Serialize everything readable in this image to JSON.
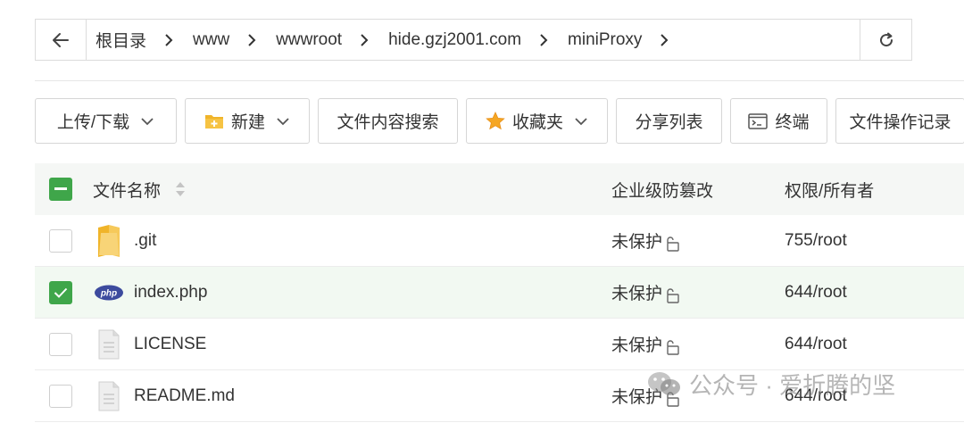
{
  "breadcrumb": {
    "items": [
      "根目录",
      "www",
      "wwwroot",
      "hide.gzj2001.com",
      "miniProxy"
    ]
  },
  "toolbar": {
    "upload_download": "上传/下载",
    "new": "新建",
    "content_search": "文件内容搜索",
    "favorites": "收藏夹",
    "share_list": "分享列表",
    "terminal": "终端",
    "operation_log": "文件操作记录"
  },
  "table": {
    "headers": {
      "name": "文件名称",
      "protect": "企业级防篡改",
      "perm": "权限/所有者"
    },
    "rows": [
      {
        "name": ".git",
        "protect": "未保护",
        "perm": "755/root",
        "type": "folder",
        "checked": false
      },
      {
        "name": "index.php",
        "protect": "未保护",
        "perm": "644/root",
        "type": "php",
        "checked": true
      },
      {
        "name": "LICENSE",
        "protect": "未保护",
        "perm": "644/root",
        "type": "file",
        "checked": false
      },
      {
        "name": "README.md",
        "protect": "未保护",
        "perm": "644/root",
        "type": "file",
        "checked": false
      }
    ]
  },
  "icons": {
    "php_label": "php"
  },
  "watermark": {
    "text": "公众号 · 爱折腾的坚"
  },
  "colors": {
    "accent_green": "#3fa64a",
    "selected_row": "#f2f9f2",
    "header_bg": "#f5f7f5",
    "php_blue": "#3d4b9e",
    "folder_yellow": "#f6c343"
  }
}
